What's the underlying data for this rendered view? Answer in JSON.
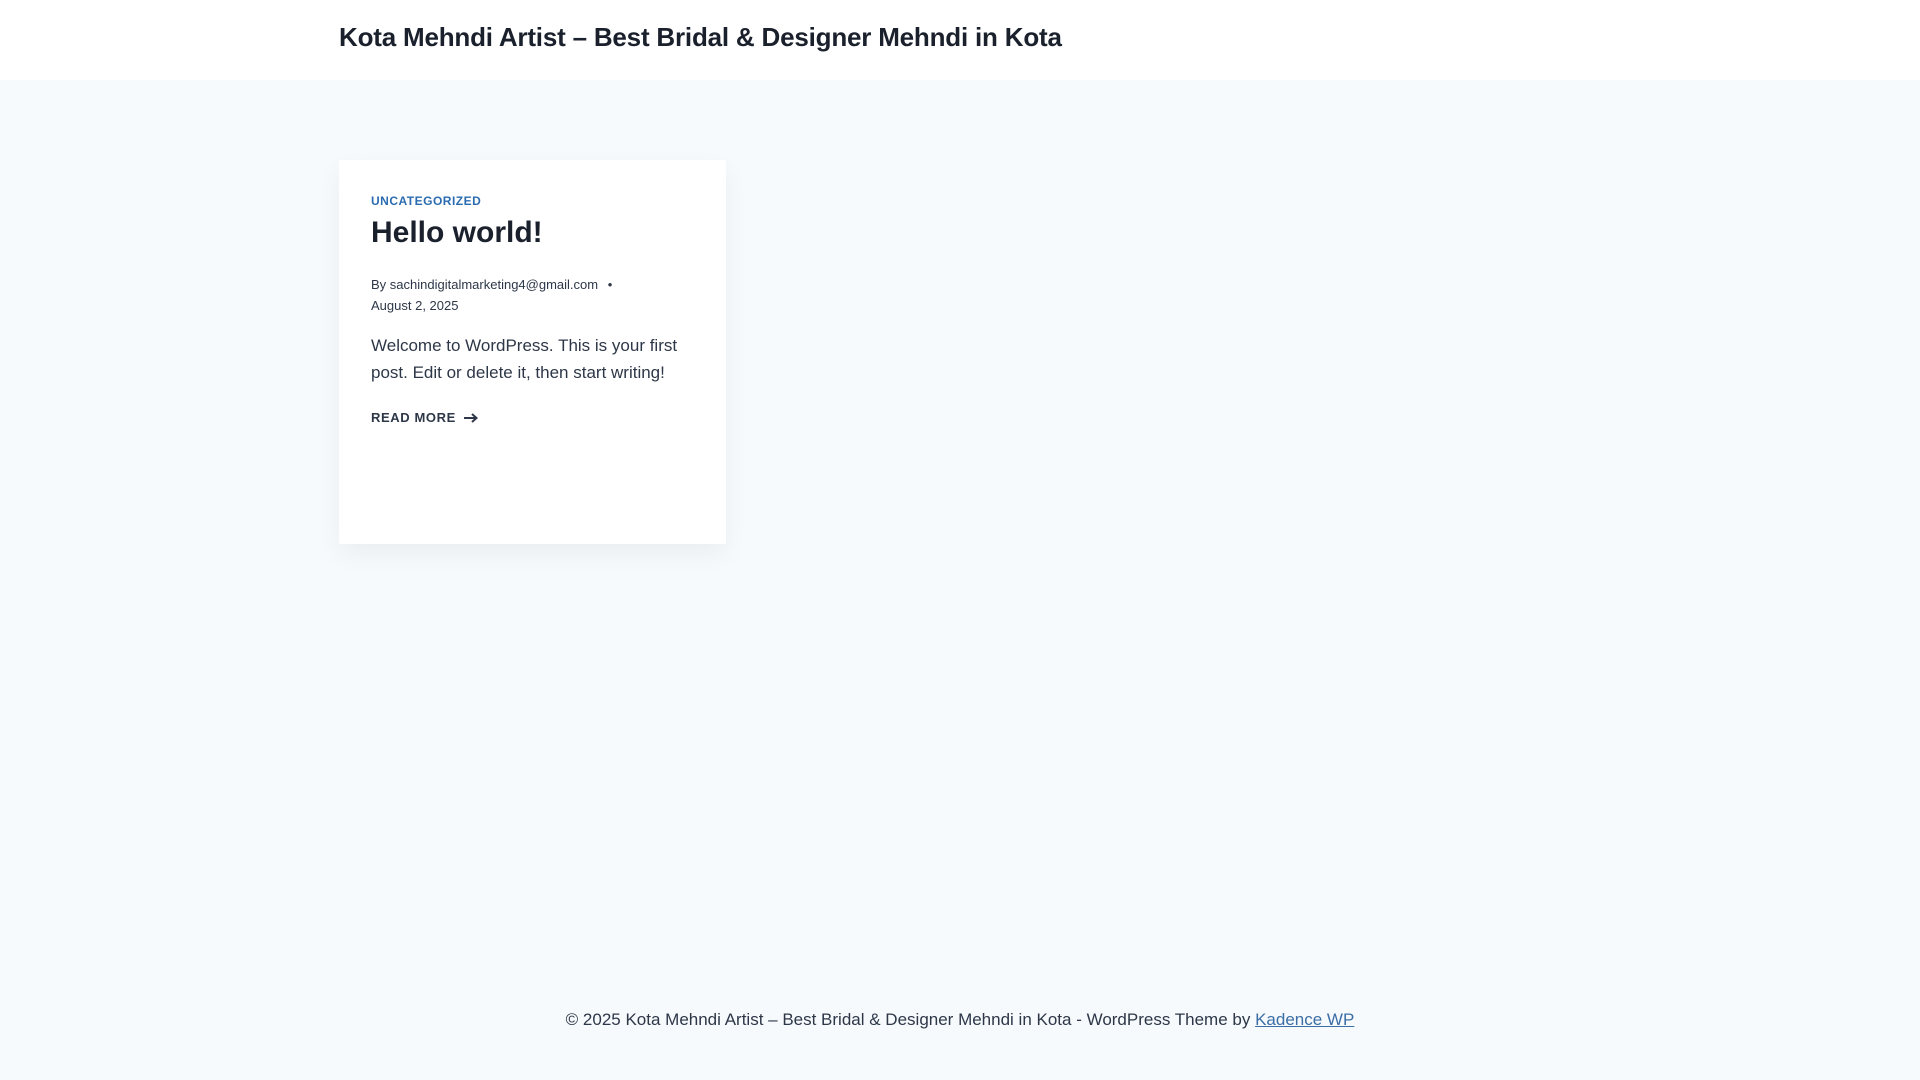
{
  "header": {
    "site_title": "Kota Mehndi Artist – Best Bridal & Designer Mehndi in Kota"
  },
  "post": {
    "category": "UNCATEGORIZED",
    "title": "Hello world!",
    "meta": {
      "by_label": "By",
      "author": "sachindigitalmarketing4@gmail.com",
      "separator": "•",
      "date": "August 2, 2025"
    },
    "excerpt": "Welcome to WordPress. This is your first post. Edit or delete it, then start writing!",
    "read_more_label": "READ MORE"
  },
  "footer": {
    "text": "© 2025 Kota Mehndi Artist – Best Bridal & Designer Mehndi in Kota - WordPress Theme by",
    "link_label": "Kadence WP"
  },
  "colors": {
    "page_background": "#f7fafc",
    "card_background": "#ffffff",
    "accent": "#2b6cb0",
    "text": "#1a202c",
    "link": "#3a6ea5"
  },
  "icons": {
    "read_more_arrow": "arrow-right-icon"
  }
}
